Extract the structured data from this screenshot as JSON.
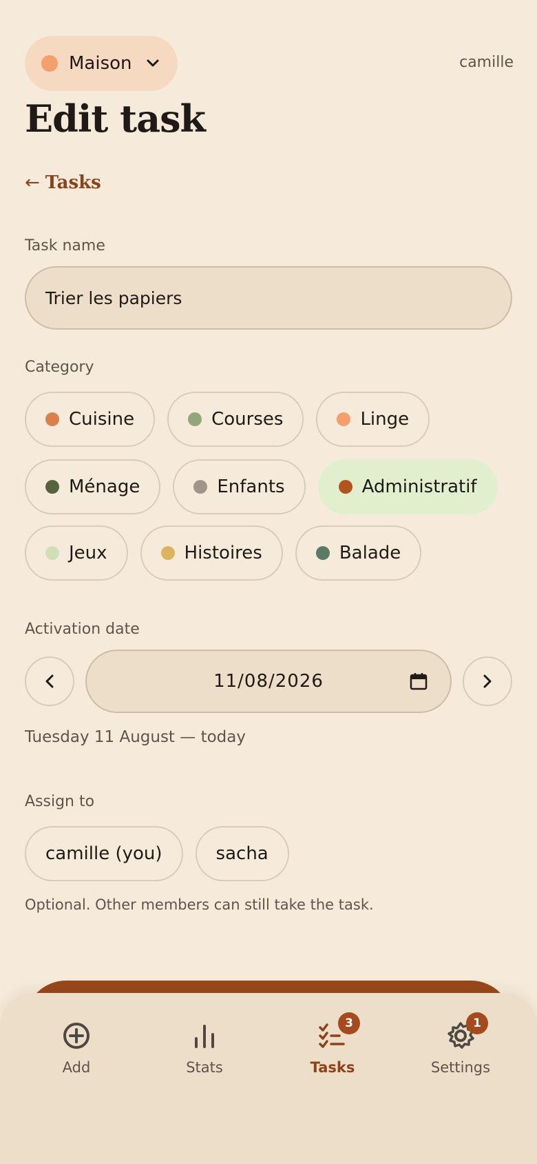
{
  "header": {
    "house_name": "Maison",
    "house_color": "#f4a06d",
    "user": "camille",
    "title": "Edit task",
    "back_label": "Tasks"
  },
  "form": {
    "task_name_label": "Task name",
    "task_name_value": "Trier les papiers",
    "category_label": "Category",
    "categories": [
      {
        "label": "Cuisine",
        "color": "#d9804d",
        "selected": false
      },
      {
        "label": "Courses",
        "color": "#93a677",
        "selected": false
      },
      {
        "label": "Linge",
        "color": "#f4a06d",
        "selected": false
      },
      {
        "label": "Ménage",
        "color": "#55643c",
        "selected": false
      },
      {
        "label": "Enfants",
        "color": "#a09588",
        "selected": false
      },
      {
        "label": "Administratif",
        "color": "#b3541f",
        "selected": true
      },
      {
        "label": "Jeux",
        "color": "#d1dfb7",
        "selected": false
      },
      {
        "label": "Histoires",
        "color": "#dcb35e",
        "selected": false
      },
      {
        "label": "Balade",
        "color": "#5b7a66",
        "selected": false
      }
    ],
    "activation_label": "Activation date",
    "date_value": "11/08/2026",
    "date_caption": "Tuesday 11 August — today",
    "assign_label": "Assign to",
    "assignees": [
      "camille (you)",
      "sacha"
    ],
    "optional_note": "Optional. Other members can still take the task."
  },
  "nav": {
    "items": [
      {
        "label": "Add",
        "icon": "plus-circle-icon",
        "active": false,
        "badge": ""
      },
      {
        "label": "Stats",
        "icon": "bar-chart-icon",
        "active": false,
        "badge": ""
      },
      {
        "label": "Tasks",
        "icon": "checklist-icon",
        "active": true,
        "badge": "3"
      },
      {
        "label": "Settings",
        "icon": "gear-icon",
        "active": false,
        "badge": "1"
      }
    ]
  },
  "colors": {
    "accent": "#8e4219",
    "background": "#f6ebdb",
    "selected_chip": "#e1efcf",
    "save_button": "#97461a"
  }
}
